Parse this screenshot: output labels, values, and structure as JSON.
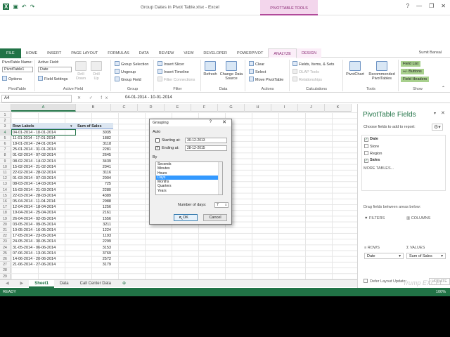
{
  "window": {
    "title": "Group Dates in Pivot Table.xlsx - Excel",
    "context_header": "PIVOTTABLE TOOLS",
    "controls": [
      "?",
      "—",
      "❐",
      "✕"
    ]
  },
  "tabs": [
    "FILE",
    "HOME",
    "INSERT",
    "PAGE LAYOUT",
    "FORMULAS",
    "DATA",
    "REVIEW",
    "VIEW",
    "DEVELOPER",
    "POWERPIVOT",
    "ANALYZE",
    "DESIGN"
  ],
  "user": "Sumit Bansal",
  "ribbon": {
    "pivottable": {
      "name_label": "PivotTable Name:",
      "name_value": "PivotTable1",
      "options": "Options",
      "group": "PivotTable"
    },
    "active_field": {
      "label": "Active Field:",
      "value": "Date",
      "settings": "Field Settings",
      "drill_down": "Drill Down",
      "drill_up": "Drill Up",
      "group": "Active Field"
    },
    "group": {
      "selection": "Group Selection",
      "ungroup": "Ungroup",
      "field": "Group Field",
      "group": "Group"
    },
    "filter": {
      "slicer": "Insert Slicer",
      "timeline": "Insert Timeline",
      "connections": "Filter Connections",
      "group": "Filter"
    },
    "data": {
      "refresh": "Refresh",
      "change_source": "Change Data Source",
      "group": "Data"
    },
    "actions": {
      "clear": "Clear",
      "select": "Select",
      "move": "Move PivotTable",
      "group": "Actions"
    },
    "calculations": {
      "fields": "Fields, Items, & Sets",
      "olap": "OLAP Tools",
      "relationships": "Relationships",
      "group": "Calculations"
    },
    "tools": {
      "pivotchart": "PivotChart",
      "recommended": "Recommended PivotTables",
      "group": "Tools"
    },
    "show": {
      "field_list": "Field List",
      "buttons": "+/- Buttons",
      "headers": "Field Headers",
      "group": "Show"
    }
  },
  "formula_bar": {
    "name_box": "A4",
    "fx": "✕ ✓ fx",
    "value": "04-01-2014 - 10-01-2014"
  },
  "columns": [
    "A",
    "B",
    "C",
    "D",
    "E",
    "F",
    "G",
    "H",
    "I",
    "J",
    "K"
  ],
  "rows_start": 1,
  "pivot": {
    "header_row_labels": "Row Labels",
    "header_sum": "Sum of Sales",
    "rows": [
      [
        "04-01-2014 - 10-01-2014",
        "3035"
      ],
      [
        "11-01-2014 - 17-01-2014",
        "1882"
      ],
      [
        "18-01-2014 - 24-01-2014",
        "3118"
      ],
      [
        "25-01-2014 - 31-01-2014",
        "2281"
      ],
      [
        "01-02-2014 - 07-02-2014",
        "2645"
      ],
      [
        "08-02-2014 - 14-02-2014",
        "3439"
      ],
      [
        "15-02-2014 - 21-02-2014",
        "2041"
      ],
      [
        "22-02-2014 - 28-02-2014",
        "3116"
      ],
      [
        "01-03-2014 - 07-03-2014",
        "2004"
      ],
      [
        "08-03-2014 - 14-03-2014",
        "725"
      ],
      [
        "15-03-2014 - 21-03-2014",
        "2280"
      ],
      [
        "22-03-2014 - 28-03-2014",
        "4389"
      ],
      [
        "05-04-2014 - 11-04-2014",
        "2988"
      ],
      [
        "12-04-2014 - 18-04-2014",
        "1256"
      ],
      [
        "19-04-2014 - 25-04-2014",
        "2161"
      ],
      [
        "26-04-2014 - 02-05-2014",
        "1556"
      ],
      [
        "03-05-2014 - 09-05-2014",
        "3211"
      ],
      [
        "10-05-2014 - 16-05-2014",
        "1224"
      ],
      [
        "17-05-2014 - 23-05-2014",
        "1193"
      ],
      [
        "24-05-2014 - 30-05-2014",
        "2299"
      ],
      [
        "31-05-2014 - 06-06-2014",
        "3153"
      ],
      [
        "07-06-2014 - 13-06-2014",
        "3769"
      ],
      [
        "14-06-2014 - 20-06-2014",
        "2572"
      ],
      [
        "21-06-2014 - 27-06-2014",
        "3179"
      ]
    ]
  },
  "dialog": {
    "title": "Grouping",
    "help": "?",
    "close": "✕",
    "auto": "Auto",
    "starting_label": "Starting at:",
    "starting_value": "30-12-2013",
    "starting_checked": false,
    "ending_label": "Ending at:",
    "ending_value": "28-12-2015",
    "ending_checked": true,
    "by": "By",
    "by_options": [
      "Seconds",
      "Minutes",
      "Hours",
      "Days",
      "Months",
      "Quarters",
      "Years"
    ],
    "by_selected": "Days",
    "days_label": "Number of days:",
    "days_value": "7",
    "ok": "OK",
    "cancel": "Cancel"
  },
  "sheet_tabs": [
    "Sheet1",
    "Data",
    "Call Center Data"
  ],
  "status": {
    "ready": "READY",
    "zoom": "100%"
  },
  "pane": {
    "title": "PivotTable Fields",
    "subtitle": "Choose fields to add to report:",
    "fields": [
      {
        "name": "Date",
        "checked": true
      },
      {
        "name": "Store",
        "checked": false
      },
      {
        "name": "Region",
        "checked": false
      },
      {
        "name": "Sales",
        "checked": true
      }
    ],
    "more_tables": "MORE TABLES...",
    "drag_text": "Drag fields between areas below:",
    "filters": "FILTERS",
    "columns": "COLUMNS",
    "rows": "ROWS",
    "values": "VALUES",
    "rows_item": "Date",
    "values_item": "Sum of Sales",
    "defer": "Defer Layout Update",
    "update": "UPDATE"
  },
  "watermark": "Trump EXCEL"
}
